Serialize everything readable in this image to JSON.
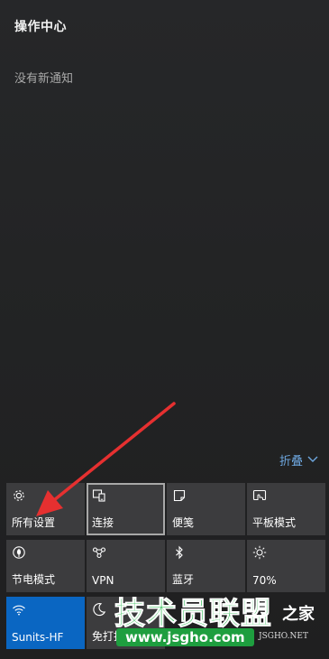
{
  "header": {
    "title": "操作中心",
    "empty_message": "没有新通知"
  },
  "collapse": {
    "label": "折叠"
  },
  "quick_actions": [
    {
      "label": "所有设置",
      "icon": "gear-icon",
      "state": "normal"
    },
    {
      "label": "连接",
      "icon": "connect-icon",
      "state": "selected"
    },
    {
      "label": "便笺",
      "icon": "note-icon",
      "state": "normal"
    },
    {
      "label": "平板模式",
      "icon": "tablet-mode-icon",
      "state": "normal"
    },
    {
      "label": "节电模式",
      "icon": "battery-saver-icon",
      "state": "normal"
    },
    {
      "label": "VPN",
      "icon": "vpn-icon",
      "state": "normal"
    },
    {
      "label": "蓝牙",
      "icon": "bluetooth-icon",
      "state": "normal"
    },
    {
      "label": "70%",
      "icon": "brightness-icon",
      "state": "normal"
    },
    {
      "label": "Sunits-HF",
      "icon": "wifi-icon",
      "state": "active"
    },
    {
      "label": "免打扰",
      "icon": "moon-icon",
      "state": "normal"
    }
  ],
  "watermark": {
    "brand": "技术员联盟",
    "suffix": "之家",
    "url": "www.jsgho.com",
    "english": "JSGHO.NET"
  },
  "colors": {
    "accent": "#0a66c2",
    "link": "#6ea8e0",
    "tile": "#3c3c3e",
    "arrow": "#e63030"
  }
}
